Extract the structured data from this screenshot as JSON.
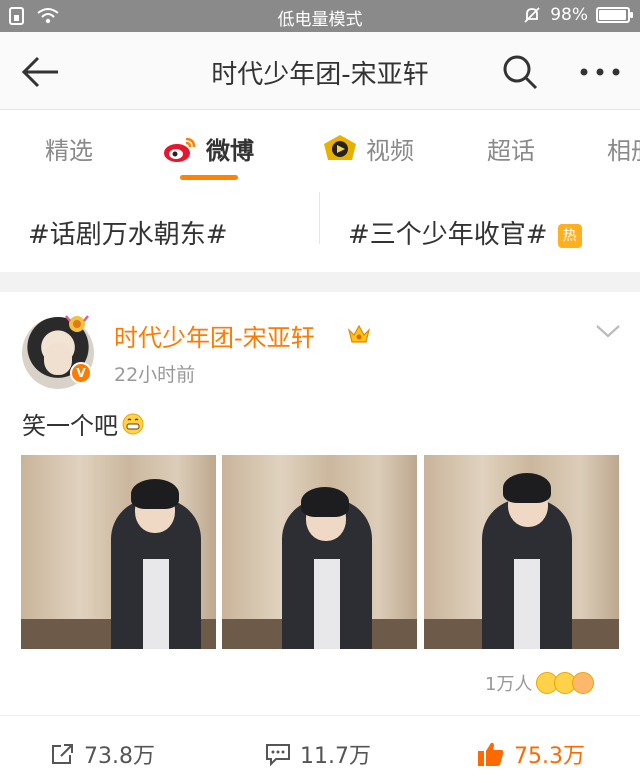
{
  "status_bar": {
    "mode": "低电量模式",
    "battery": "98%",
    "battery_level": 0.98,
    "icons": [
      "sim-icon",
      "wifi-icon",
      "mute-bell-icon",
      "battery-icon"
    ]
  },
  "nav": {
    "title": "时代少年团-宋亚轩",
    "icons": [
      "back-arrow-icon",
      "search-icon",
      "more-icon"
    ]
  },
  "tabs": [
    {
      "label": "精选",
      "active": false
    },
    {
      "label": "微博",
      "active": true,
      "icon": "weibo-logo-icon"
    },
    {
      "label": "视频",
      "active": false,
      "icon": "video-play-icon"
    },
    {
      "label": "超话",
      "active": false
    },
    {
      "label": "相册",
      "active": false
    }
  ],
  "topics": [
    {
      "label": "#话剧万水朝东#"
    },
    {
      "label": "#三个少年收官#",
      "badge": "热"
    }
  ],
  "post": {
    "author": "时代少年团-宋亚轩",
    "verified_badge": "V",
    "time": "22小时前",
    "text": "笑一个吧",
    "reactions_text": "1万人",
    "actions": {
      "repost": "73.8万",
      "comment": "11.7万",
      "like": "75.3万"
    }
  },
  "colors": {
    "accent": "#ff8200",
    "author": "#ff7a00",
    "like": "#ff6a00"
  }
}
